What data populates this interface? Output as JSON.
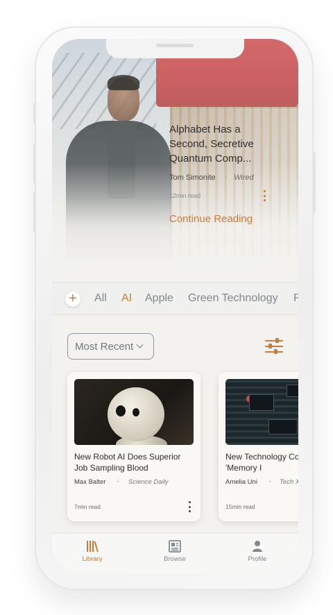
{
  "featured": {
    "title": "Alphabet Has a Second, Secretive Quantum Comp...",
    "author": "Tom Simonite",
    "separator": "·",
    "source": "Wired",
    "read_time": "12min read",
    "cta": "Continue Reading"
  },
  "categories": {
    "add_label": "+",
    "tabs": [
      "All",
      "AI",
      "Apple",
      "Green Technology",
      "R"
    ],
    "active": "AI"
  },
  "sort": {
    "selected": "Most Recent"
  },
  "articles": [
    {
      "title": "New Robot AI Does Superior Job Sampling Blood",
      "author": "Max Balter",
      "separator": "·",
      "source": "Science Daily",
      "read_time": "7min read",
      "image": "robot-photo"
    },
    {
      "title": "New Technology Co Solve AI's 'Memory I",
      "author": "Amelia Uni",
      "separator": "·",
      "source": "Tech X",
      "read_time": "15min read",
      "image": "circuit-board-photo"
    }
  ],
  "nav": {
    "items": [
      {
        "label": "Library",
        "icon": "library-icon"
      },
      {
        "label": "Browse",
        "icon": "browse-icon"
      },
      {
        "label": "Profile",
        "icon": "profile-icon"
      }
    ],
    "active": "Library"
  },
  "colors": {
    "accent": "#c87c37",
    "muted_text": "#7c8a90",
    "background": "#f3f2ee"
  }
}
